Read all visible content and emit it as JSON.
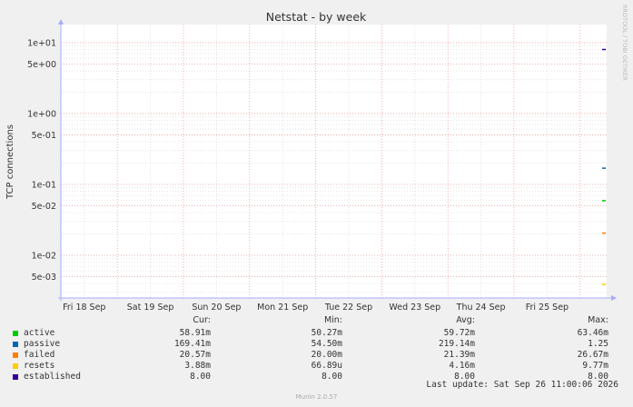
{
  "chart_data": {
    "type": "line",
    "title": "Netstat - by week",
    "ylabel": "TCP connections",
    "xlabel": "",
    "yscale": "log",
    "ylim": [
      0.0025,
      18
    ],
    "y_ticks": [
      {
        "value": 10,
        "label": "1e+01"
      },
      {
        "value": 5,
        "label": "5e+00"
      },
      {
        "value": 1,
        "label": "1e+00"
      },
      {
        "value": 0.5,
        "label": "5e-01"
      },
      {
        "value": 0.1,
        "label": "1e-01"
      },
      {
        "value": 0.05,
        "label": "5e-02"
      },
      {
        "value": 0.01,
        "label": "1e-02"
      },
      {
        "value": 0.005,
        "label": "5e-03"
      }
    ],
    "x_tick_labels": [
      "Fri 18 Sep",
      "Sat 19 Sep",
      "Sun 20 Sep",
      "Mon 21 Sep",
      "Tue 22 Sep",
      "Wed 23 Sep",
      "Thu 24 Sep",
      "Fri 25 Sep"
    ],
    "grid": true,
    "legend_position": "bottom",
    "series": [
      {
        "name": "active",
        "color": "#00cc00",
        "values": [
          0.05891
        ]
      },
      {
        "name": "passive",
        "color": "#0066b3",
        "values": [
          0.16941
        ]
      },
      {
        "name": "failed",
        "color": "#ff8000",
        "values": [
          0.02057
        ]
      },
      {
        "name": "resets",
        "color": "#ffcc00",
        "values": [
          0.00388
        ]
      },
      {
        "name": "established",
        "color": "#330099",
        "values": [
          8.0
        ]
      }
    ]
  },
  "legend": {
    "headers": {
      "cur": "Cur:",
      "min": "Min:",
      "avg": "Avg:",
      "max": "Max:"
    },
    "rows": [
      {
        "name": "active",
        "color": "#00cc00",
        "cur": "58.91m",
        "min": "50.27m",
        "avg": "59.72m",
        "max": "63.46m"
      },
      {
        "name": "passive",
        "color": "#0066b3",
        "cur": "169.41m",
        "min": "54.50m",
        "avg": "219.14m",
        "max": "1.25"
      },
      {
        "name": "failed",
        "color": "#ff8000",
        "cur": "20.57m",
        "min": "20.00m",
        "avg": "21.39m",
        "max": "26.67m"
      },
      {
        "name": "resets",
        "color": "#ffcc00",
        "cur": "3.88m",
        "min": "66.89u",
        "avg": "4.16m",
        "max": "9.77m"
      },
      {
        "name": "established",
        "color": "#330099",
        "cur": "8.00",
        "min": "8.00",
        "avg": "8.00",
        "max": "8.00"
      }
    ]
  },
  "side_label": "RRDTOOL / TOBI OETIKER",
  "last_update": "Last update: Sat Sep 26 11:00:06 2026",
  "version": "Munin 2.0.57"
}
